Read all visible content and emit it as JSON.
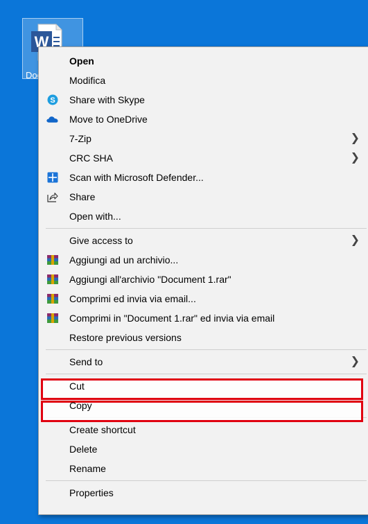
{
  "desktop": {
    "file_label": "Doc"
  },
  "menu": {
    "open": "Open",
    "modifica": "Modifica",
    "share_skype": "Share with Skype",
    "move_onedrive": "Move to OneDrive",
    "zip": "7-Zip",
    "crc": "CRC SHA",
    "defender": "Scan with Microsoft Defender...",
    "share": "Share",
    "open_with": "Open with...",
    "give_access": "Give access to",
    "rar_add": "Aggiungi ad un archivio...",
    "rar_add_named": "Aggiungi all'archivio \"Document 1.rar\"",
    "rar_email": "Comprimi ed invia via email...",
    "rar_email_named": "Comprimi in \"Document 1.rar\" ed invia via email",
    "restore": "Restore previous versions",
    "send_to": "Send to",
    "cut": "Cut",
    "copy": "Copy",
    "create_shortcut": "Create shortcut",
    "delete": "Delete",
    "rename": "Rename",
    "properties": "Properties"
  },
  "colors": {
    "desktop_bg": "#0b76d9",
    "menu_bg": "#f2f2f2",
    "highlight_border": "#e00010",
    "skype": "#1e9ee0",
    "onedrive": "#1166c9",
    "defender": "#1b74d8",
    "winrar": "#8b2a6b"
  }
}
